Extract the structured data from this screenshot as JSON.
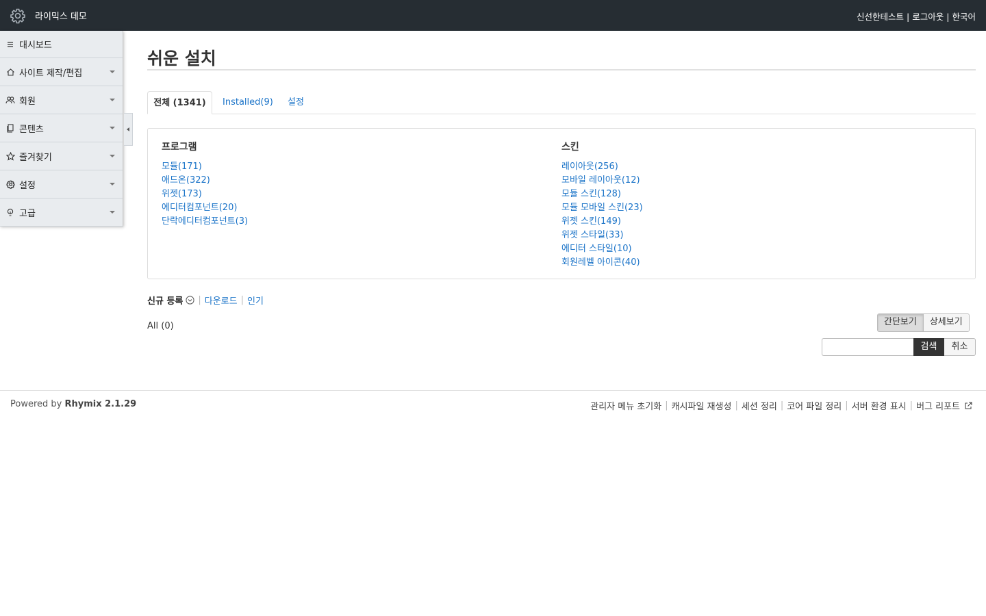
{
  "header": {
    "site_title": "라이믹스 데모",
    "user_links": [
      "신선한테스트",
      "로그아웃",
      "한국어"
    ],
    "logo_icon": "gear-icon",
    "bg_color": "#262d33"
  },
  "sidebar": {
    "items": [
      {
        "label": "대시보드",
        "icon": "list-icon"
      },
      {
        "label": "사이트 제작/편집",
        "icon": "home-icon"
      },
      {
        "label": "회원",
        "icon": "users-icon"
      },
      {
        "label": "콘텐츠",
        "icon": "documents-icon"
      },
      {
        "label": "즐겨찾기",
        "icon": "star-icon"
      },
      {
        "label": "설정",
        "icon": "gear-icon"
      },
      {
        "label": "고급",
        "icon": "bulb-icon"
      }
    ]
  },
  "main": {
    "title": "쉬운 설치",
    "tabs": [
      "전체 (1341)",
      "Installed(9)",
      "설정"
    ],
    "categories": {
      "program": {
        "heading": "프로그램",
        "links": [
          "모듈(171)",
          "애드온(322)",
          "위젯(173)",
          "에디터컴포넌트(20)",
          "단락에디터컴포넌트(3)"
        ]
      },
      "skin": {
        "heading": "스킨",
        "links": [
          "레이아웃(256)",
          "모바일 레이아웃(12)",
          "모듈 스킨(128)",
          "모듈 모바일 스킨(23)",
          "위젯 스킨(149)",
          "위젯 스타일(33)",
          "에디터 스타일(10)",
          "회원레벨 아이콘(40)"
        ]
      }
    },
    "sort": {
      "active": "신규 등록",
      "options": [
        "다운로드",
        "인기"
      ]
    },
    "all_count": "All (0)",
    "view_toggle": [
      "간단보기",
      "상세보기"
    ],
    "search": {
      "value": "",
      "search_label": "검색",
      "cancel_label": "취소"
    },
    "link_color": "#1a73c8"
  },
  "footer": {
    "powered_prefix": "Powered by ",
    "powered_product": "Rhymix 2.1.29",
    "links": [
      "관리자 메뉴 초기화",
      "캐시파일 재생성",
      "세션 정리",
      "코어 파일 정리",
      "서버 환경 표시",
      "버그 리포트"
    ]
  }
}
